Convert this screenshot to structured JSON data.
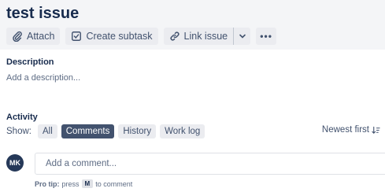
{
  "issue": {
    "title": "test issue"
  },
  "toolbar": {
    "attach_label": "Attach",
    "subtask_label": "Create subtask",
    "link_label": "Link issue",
    "more_label": "•••"
  },
  "description": {
    "heading": "Description",
    "placeholder": "Add a description..."
  },
  "activity": {
    "heading": "Activity",
    "show_label": "Show:",
    "filters": [
      "All",
      "Comments",
      "History",
      "Work log"
    ],
    "active_filter": "Comments",
    "sort_label": "Newest first"
  },
  "comment": {
    "avatar_initials": "MK",
    "placeholder": "Add a comment...",
    "protip_bold": "Pro tip:",
    "protip_pre": "press",
    "protip_key": "M",
    "protip_post": "to comment"
  },
  "colors": {
    "active_filter_bg": "#42526e",
    "avatar_bg": "#253858",
    "header_band": "#f4f5f7"
  }
}
